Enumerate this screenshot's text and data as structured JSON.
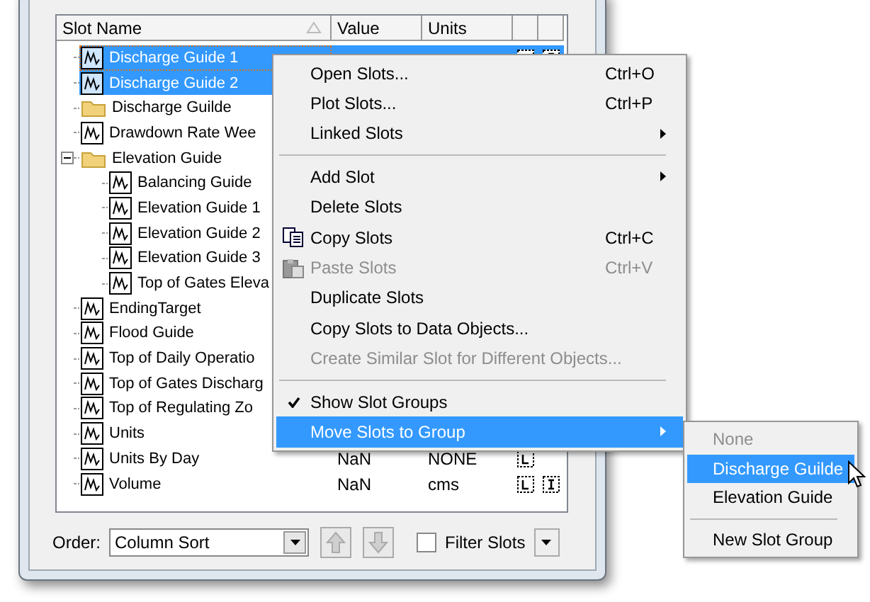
{
  "table": {
    "columns": [
      "Slot Name",
      "Value",
      "Units"
    ],
    "rows": [
      {
        "name": "Discharge Guide 1",
        "kind": "slot",
        "selected": true,
        "focused": true,
        "column_4_icon": true,
        "column_5_icon": true
      },
      {
        "name": "Discharge Guide 2",
        "kind": "slot",
        "selected": true,
        "focused": false
      },
      {
        "name": "Discharge Guilde",
        "kind": "group",
        "selected": false,
        "focused": false
      },
      {
        "name": "Drawdown Rate Wee",
        "kind": "slot",
        "selected": false,
        "focused": false
      },
      {
        "name": "Elevation Guide",
        "kind": "group",
        "selected": false,
        "focused": false,
        "expanded": true,
        "children": [
          {
            "name": "Balancing Guide",
            "kind": "slot",
            "selected": false,
            "focused": false
          },
          {
            "name": "Elevation Guide 1",
            "kind": "slot",
            "selected": false,
            "focused": false
          },
          {
            "name": "Elevation Guide 2",
            "kind": "slot",
            "selected": false,
            "focused": false
          },
          {
            "name": "Elevation Guide 3",
            "kind": "slot",
            "selected": false,
            "focused": false
          },
          {
            "name": "Top of Gates Eleva",
            "kind": "slot",
            "selected": false,
            "focused": false
          }
        ]
      },
      {
        "name": "EndingTarget",
        "kind": "slot",
        "selected": false,
        "focused": false
      },
      {
        "name": "Flood Guide",
        "kind": "slot",
        "selected": false,
        "focused": false
      },
      {
        "name": "Top of Daily Operatio",
        "kind": "slot",
        "selected": false,
        "focused": false
      },
      {
        "name": "Top of Gates Discharg",
        "kind": "slot",
        "selected": false,
        "focused": false
      },
      {
        "name": "Top of Regulating Zo",
        "kind": "slot",
        "selected": false,
        "focused": false
      },
      {
        "name": "Units",
        "kind": "slot",
        "selected": false,
        "focused": false
      },
      {
        "name": "Units By Day",
        "kind": "slot",
        "selected": false,
        "focused": false,
        "value": "NaN",
        "units": "NONE",
        "column_4_icon": true,
        "column_5_icon": false
      },
      {
        "name": "Volume",
        "kind": "slot",
        "selected": false,
        "focused": false,
        "value": "NaN",
        "units": "cms",
        "column_4_icon": true,
        "column_5_icon": true
      }
    ]
  },
  "order": {
    "label": "Order:",
    "value": "Column Sort"
  },
  "filter": {
    "label": "Filter Slots",
    "checked": false
  },
  "context_menu": [
    {
      "kind": "item",
      "label": "Open Slots...",
      "shortcut": "Ctrl+O",
      "submenu": false,
      "disabled": false,
      "checked": false,
      "selected": false
    },
    {
      "kind": "item",
      "label": "Plot Slots...",
      "shortcut": "Ctrl+P",
      "submenu": false,
      "disabled": false,
      "checked": false,
      "selected": false
    },
    {
      "kind": "item",
      "label": "Linked Slots",
      "submenu": true,
      "disabled": false,
      "checked": false,
      "selected": false
    },
    {
      "kind": "separator"
    },
    {
      "kind": "item",
      "label": "Add Slot",
      "submenu": true,
      "disabled": false,
      "checked": false,
      "selected": false
    },
    {
      "kind": "item",
      "label": "Delete Slots",
      "submenu": false,
      "disabled": false,
      "checked": false,
      "selected": false
    },
    {
      "kind": "copy",
      "label": "Copy Slots",
      "shortcut": "Ctrl+C",
      "submenu": false,
      "disabled": false,
      "checked": false,
      "selected": false
    },
    {
      "kind": "paste",
      "label": "Paste Slots",
      "shortcut": "Ctrl+V",
      "submenu": false,
      "disabled": true,
      "checked": false,
      "selected": false
    },
    {
      "kind": "item",
      "label": "Duplicate Slots",
      "submenu": false,
      "disabled": false,
      "checked": false,
      "selected": false
    },
    {
      "kind": "item",
      "label": "Copy Slots to Data Objects...",
      "submenu": false,
      "disabled": false,
      "checked": false,
      "selected": false
    },
    {
      "kind": "item",
      "label": "Create Similar Slot for Different Objects...",
      "submenu": false,
      "disabled": true,
      "checked": false,
      "selected": false
    },
    {
      "kind": "separator"
    },
    {
      "kind": "item",
      "label": "Show Slot Groups",
      "submenu": false,
      "disabled": false,
      "checked": true,
      "selected": false
    },
    {
      "kind": "item",
      "label": "Move Slots to Group",
      "submenu": true,
      "disabled": false,
      "checked": false,
      "selected": true
    }
  ],
  "submenu": [
    {
      "kind": "item",
      "label": "None",
      "disabled": true,
      "selected": false
    },
    {
      "kind": "item",
      "label": "Discharge Guilde",
      "disabled": false,
      "selected": true
    },
    {
      "kind": "item",
      "label": "Elevation Guide",
      "disabled": false,
      "selected": false
    },
    {
      "kind": "separator"
    },
    {
      "kind": "item",
      "label": "New Slot Group",
      "disabled": false,
      "selected": false
    }
  ]
}
